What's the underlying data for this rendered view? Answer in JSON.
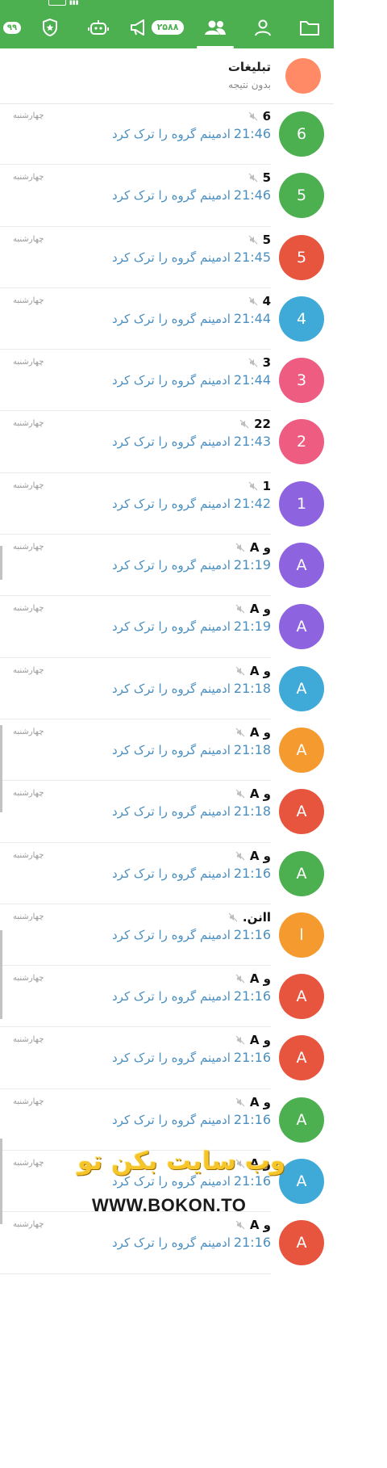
{
  "colors": {
    "tabbar": "#4caf50",
    "message": "#4a8fc0",
    "day": "#9a9a9a"
  },
  "tabs": [
    {
      "icon": "folder-icon"
    },
    {
      "icon": "person-icon"
    },
    {
      "icon": "people-icon",
      "active": true
    },
    {
      "icon": "megaphone-icon",
      "badge": "۲۵۸۸"
    },
    {
      "icon": "robot-icon"
    },
    {
      "icon": "shield-star-icon"
    },
    {
      "icon": "more-icon",
      "badge": "۹۹"
    }
  ],
  "ads": {
    "title": "تبلیغات",
    "subtitle": "بدون نتیجه"
  },
  "chats": [
    {
      "avatar": "6",
      "color": "#4caf50",
      "name": "6",
      "time": "21:46",
      "message": "ادمینم گروه را ترک کرد",
      "day": "چهارشنبه"
    },
    {
      "avatar": "5",
      "color": "#4caf50",
      "name": "5",
      "time": "21:46",
      "message": "ادمینم گروه را ترک کرد",
      "day": "چهارشنبه"
    },
    {
      "avatar": "5",
      "color": "#e8553f",
      "name": "5",
      "time": "21:45",
      "message": "ادمینم گروه را ترک کرد",
      "day": "چهارشنبه"
    },
    {
      "avatar": "4",
      "color": "#3fa9d8",
      "name": "4",
      "time": "21:44",
      "message": "ادمینم گروه را ترک کرد",
      "day": "چهارشنبه"
    },
    {
      "avatar": "3",
      "color": "#ee5c82",
      "name": "3",
      "time": "21:44",
      "message": "ادمینم گروه را ترک کرد",
      "day": "چهارشنبه"
    },
    {
      "avatar": "2",
      "color": "#ee5c82",
      "name": "22",
      "time": "21:43",
      "message": "ادمینم گروه را ترک کرد",
      "day": "چهارشنبه"
    },
    {
      "avatar": "1",
      "color": "#8e63e0",
      "name": "1",
      "time": "21:42",
      "message": "ادمینم گروه را ترک کرد",
      "day": "چهارشنبه"
    },
    {
      "avatar": "A",
      "color": "#8e63e0",
      "name": "A و",
      "time": "21:19",
      "message": "ادمینم گروه را ترک کرد",
      "day": "چهارشنبه"
    },
    {
      "avatar": "A",
      "color": "#8e63e0",
      "name": "A و",
      "time": "21:19",
      "message": "ادمینم گروه را ترک کرد",
      "day": "چهارشنبه"
    },
    {
      "avatar": "A",
      "color": "#3fa9d8",
      "name": "A و",
      "time": "21:18",
      "message": "ادمینم گروه را ترک کرد",
      "day": "چهارشنبه"
    },
    {
      "avatar": "A",
      "color": "#f59a2e",
      "name": "A و",
      "time": "21:18",
      "message": "ادمینم گروه را ترک کرد",
      "day": "چهارشنبه"
    },
    {
      "avatar": "A",
      "color": "#e8553f",
      "name": "A و",
      "time": "21:18",
      "message": "ادمینم گروه را ترک کرد",
      "day": "چهارشنبه"
    },
    {
      "avatar": "A",
      "color": "#4caf50",
      "name": "A و",
      "time": "21:16",
      "message": "ادمینم گروه را ترک کرد",
      "day": "چهارشنبه"
    },
    {
      "avatar": "ا",
      "color": "#f59a2e",
      "name": "اانن.",
      "time": "21:16",
      "message": "ادمینم گروه را ترک کرد",
      "day": "چهارشنبه"
    },
    {
      "avatar": "A",
      "color": "#e8553f",
      "name": "A و",
      "time": "21:16",
      "message": "ادمینم گروه را ترک کرد",
      "day": "چهارشنبه"
    },
    {
      "avatar": "A",
      "color": "#e8553f",
      "name": "A و",
      "time": "21:16",
      "message": "ادمینم گروه را ترک کرد",
      "day": "چهارشنبه"
    },
    {
      "avatar": "A",
      "color": "#4caf50",
      "name": "A و",
      "time": "21:16",
      "message": "ادمینم گروه را ترک کرد",
      "day": "چهارشنبه"
    },
    {
      "avatar": "A",
      "color": "#3fa9d8",
      "name": "A و",
      "time": "21:16",
      "message": "ادمینم گروه را ترک کرد",
      "day": "چهارشنبه"
    },
    {
      "avatar": "A",
      "color": "#e8553f",
      "name": "A و",
      "time": "21:16",
      "message": "ادمینم گروه را ترک کرد",
      "day": "چهارشنبه"
    }
  ],
  "watermark": {
    "fa": "وب سایت بکن تو",
    "en": "WWW.BOKON.TO"
  }
}
